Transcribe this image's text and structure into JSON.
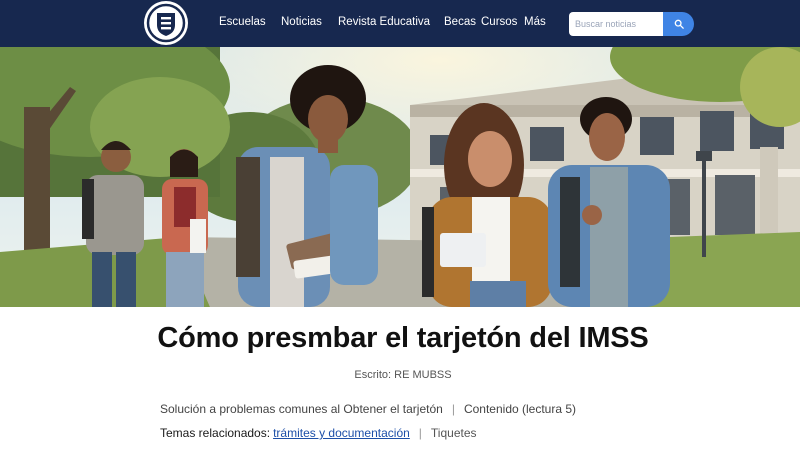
{
  "header": {
    "nav": [
      {
        "label": "Escuelas"
      },
      {
        "label": "Noticias"
      },
      {
        "label": "Revista Educativa"
      },
      {
        "label": "Becas"
      },
      {
        "label": "Cursos"
      },
      {
        "label": "Más"
      }
    ],
    "search": {
      "placeholder": "Buscar noticias",
      "button_icon": "search-icon"
    },
    "logo_icon": "university-shield-icon"
  },
  "hero": {
    "image_icon": "students-walking-campus-photo"
  },
  "article": {
    "title": "Cómo presmbar el tarjetón del IMSS",
    "byline": "Escrito: RE MUBSS",
    "meta": {
      "category": "Solución a problemas comunes al Obtener el tarjetón",
      "read_time": "Contenido (lectura 5)"
    },
    "tags": {
      "label": "Temas relacionados:",
      "link": "trámites y documentación",
      "extra": "Tiquetes"
    }
  },
  "colors": {
    "navbar": "#17284f",
    "search_button": "#3f84e5",
    "link": "#1d4fa8"
  }
}
